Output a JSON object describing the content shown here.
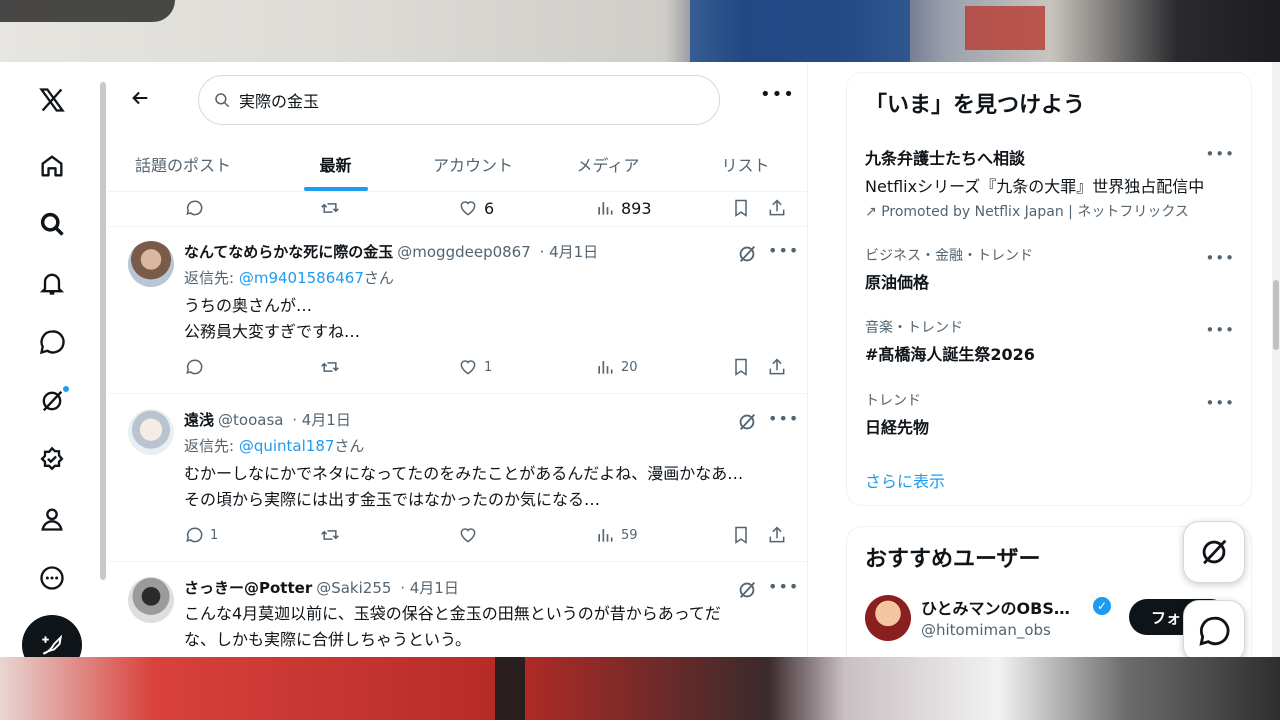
{
  "app": "X",
  "search": {
    "query": "実際の金玉"
  },
  "tabs": [
    {
      "label": "話題のポスト",
      "active": false
    },
    {
      "label": "最新",
      "active": true
    },
    {
      "label": "アカウント",
      "active": false
    },
    {
      "label": "メディア",
      "active": false
    },
    {
      "label": "リスト",
      "active": false
    }
  ],
  "top_actions": {
    "likes": "6",
    "views": "893"
  },
  "tweets": [
    {
      "name": "なんてなめらかな死に際の金玉",
      "handle": "@moggdeep0867",
      "date": "4月1日",
      "reply_prefix": "返信先: ",
      "reply_to": "@m9401586467",
      "reply_suffix": "さん",
      "lines": [
        "うちの奥さんが…",
        "公務員大変すぎですね…"
      ],
      "replies": "",
      "likes": "1",
      "views": "20"
    },
    {
      "name": "遠浅",
      "handle": "@tooasa",
      "date": "4月1日",
      "reply_prefix": "返信先: ",
      "reply_to": "@quintal187",
      "reply_suffix": "さん",
      "lines": [
        "むかーしなにかでネタになってたのをみたことがあるんだよね、漫画かなあ…",
        "その頃から実際には出す金玉ではなかったのか気になる…"
      ],
      "replies": "1",
      "likes": "",
      "views": "59"
    },
    {
      "name": "さっきー@Potter",
      "handle": "@Saki255",
      "date": "4月1日",
      "lines": [
        "こんな4月莫迦以前に、玉袋の保谷と金玉の田無というのが昔からあってだ",
        "な、しかも実際に合併しちゃうという。"
      ]
    }
  ],
  "sidebar": {
    "trends_title": "「いま」を見つけよう",
    "trends": [
      {
        "category": "",
        "name": "九条弁護士たちへ相談",
        "sub": "Netflixシリーズ『九条の大罪』世界独占配信中",
        "promo": "Promoted by Netflix Japan | ネットフリックス"
      },
      {
        "category": "ビジネス・金融・トレンド",
        "name": "原油価格"
      },
      {
        "category": "音楽・トレンド",
        "name": "#髙橋海人誕生祭2026"
      },
      {
        "category": "トレンド",
        "name": "日経先物"
      }
    ],
    "show_more": "さらに表示",
    "who_to_follow_title": "おすすめユーザー",
    "recommended": {
      "name": "ひとみマンのOBS…",
      "handle": "@hitomiman_obs",
      "follow_label": "フォ"
    }
  }
}
